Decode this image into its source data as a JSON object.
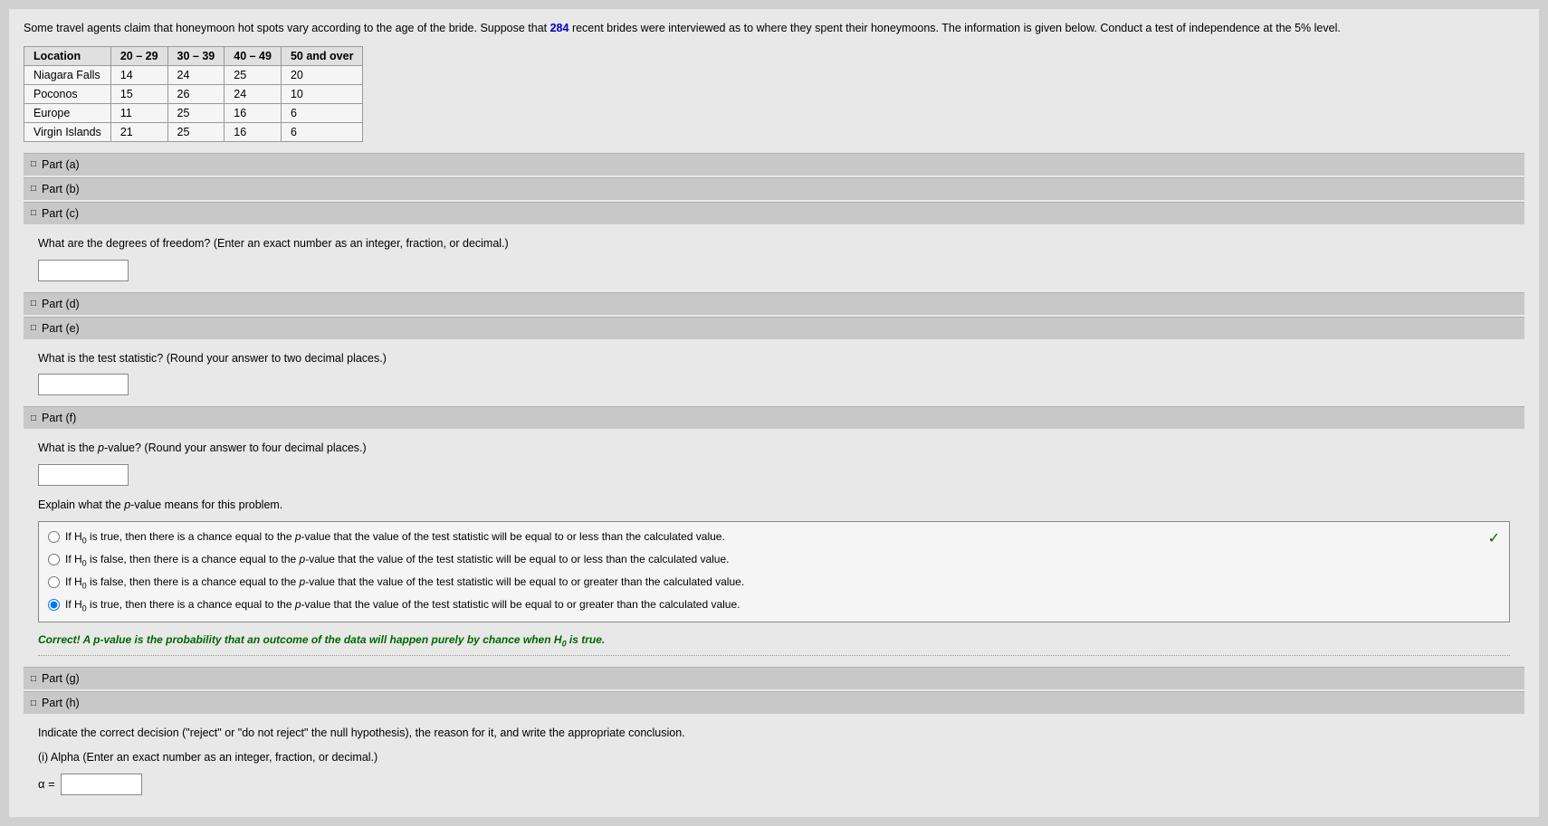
{
  "intro": {
    "text_before": "Some travel agents claim that honeymoon hot spots vary according to the age of the bride. Suppose that ",
    "highlight": "284",
    "text_after": " recent brides were interviewed as to where they spent their honeymoons. The information is given below. Conduct a test of independence at the 5% level."
  },
  "table": {
    "headers": [
      "Location",
      "20 – 29",
      "30 – 39",
      "40 – 49",
      "50 and over"
    ],
    "rows": [
      [
        "Niagara Falls",
        "14",
        "24",
        "25",
        "20"
      ],
      [
        "Poconos",
        "15",
        "26",
        "24",
        "10"
      ],
      [
        "Europe",
        "11",
        "25",
        "16",
        "6"
      ],
      [
        "Virgin Islands",
        "21",
        "25",
        "16",
        "6"
      ]
    ]
  },
  "parts": {
    "a_label": "Part (a)",
    "b_label": "Part (b)",
    "c_label": "Part (c)",
    "c_question": "What are the degrees of freedom? (Enter an exact number as an integer, fraction, or decimal.)",
    "d_label": "Part (d)",
    "e_label": "Part (e)",
    "e_question": "What is the test statistic? (Round your answer to two decimal places.)",
    "f_label": "Part (f)",
    "f_question": "What is the p-value? (Round your answer to four decimal places.)",
    "f_sub_question": "Explain what the p-value means for this problem.",
    "g_label": "Part (g)",
    "h_label": "Part (h)",
    "h_question": "Indicate the correct decision (\"reject\" or \"do not reject\" the null hypothesis), the reason for it, and write the appropriate conclusion.",
    "h_sub_question": "(i) Alpha (Enter an exact number as an integer, fraction, or decimal.)",
    "alpha_label": "α ="
  },
  "radio_options": [
    {
      "id": "opt1",
      "text": "If H₀ is true, then there is a chance equal to the p-value that the value of the test statistic will be equal to or less than the calculated value.",
      "selected": false
    },
    {
      "id": "opt2",
      "text": "If H₀ is false, then there is a chance equal to the p-value that the value of the test statistic will be equal to or less than the calculated value.",
      "selected": false
    },
    {
      "id": "opt3",
      "text": "If H₀ is false, then there is a chance equal to the p-value that the value of the test statistic will be equal to or greater than the calculated value.",
      "selected": false
    },
    {
      "id": "opt4",
      "text": "If H₀ is true, then there is a chance equal to the p-value that the value of the test statistic will be equal to or greater than the calculated value.",
      "selected": true
    }
  ],
  "correct_feedback": "Correct! A p-value is the probability that an outcome of the data will happen purely by chance when H₀ is true."
}
